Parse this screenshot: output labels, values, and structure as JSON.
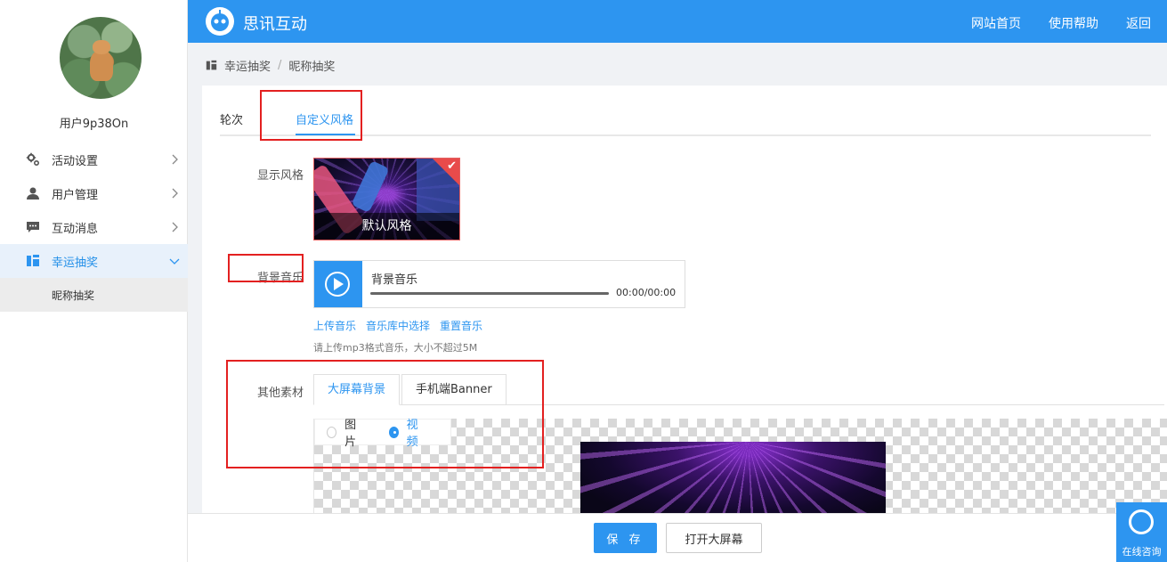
{
  "app": {
    "brand": "思讯互动",
    "nav": [
      "网站首页",
      "使用帮助",
      "返回"
    ]
  },
  "user": {
    "name": "用户9p38On"
  },
  "sidebar": {
    "items": [
      {
        "label": "活动设置",
        "icon": "gear-icon"
      },
      {
        "label": "用户管理",
        "icon": "user-icon"
      },
      {
        "label": "互动消息",
        "icon": "message-icon"
      },
      {
        "label": "幸运抽奖",
        "icon": "lottery-icon",
        "active": true
      }
    ],
    "sub_items": [
      {
        "label": "昵称抽奖",
        "active": true
      }
    ]
  },
  "breadcrumb": {
    "parent": "幸运抽奖",
    "separator": "/",
    "current": "昵称抽奖"
  },
  "tabs": [
    {
      "label": "轮次"
    },
    {
      "label": "自定义风格",
      "active": true
    }
  ],
  "form": {
    "style_label": "显示风格",
    "style_caption": "默认风格",
    "music_label": "背景音乐",
    "music_title": "背景音乐",
    "music_time": "00:00/00:00",
    "music_links": [
      "上传音乐",
      "音乐库中选择",
      "重置音乐"
    ],
    "music_hint": "请上传mp3格式音乐，大小不超过5M",
    "materials_label": "其他素材",
    "material_tabs": [
      {
        "label": "大屏幕背景",
        "active": true
      },
      {
        "label": "手机端Banner"
      }
    ],
    "media_options": [
      {
        "label": "图片",
        "checked": false
      },
      {
        "label": "视频",
        "checked": true
      }
    ]
  },
  "footer": {
    "save": "保 存",
    "open_screen": "打开大屏幕"
  },
  "consult": {
    "label": "在线咨询"
  },
  "colors": {
    "primary": "#2d95f0",
    "annotation": "#e32020"
  }
}
